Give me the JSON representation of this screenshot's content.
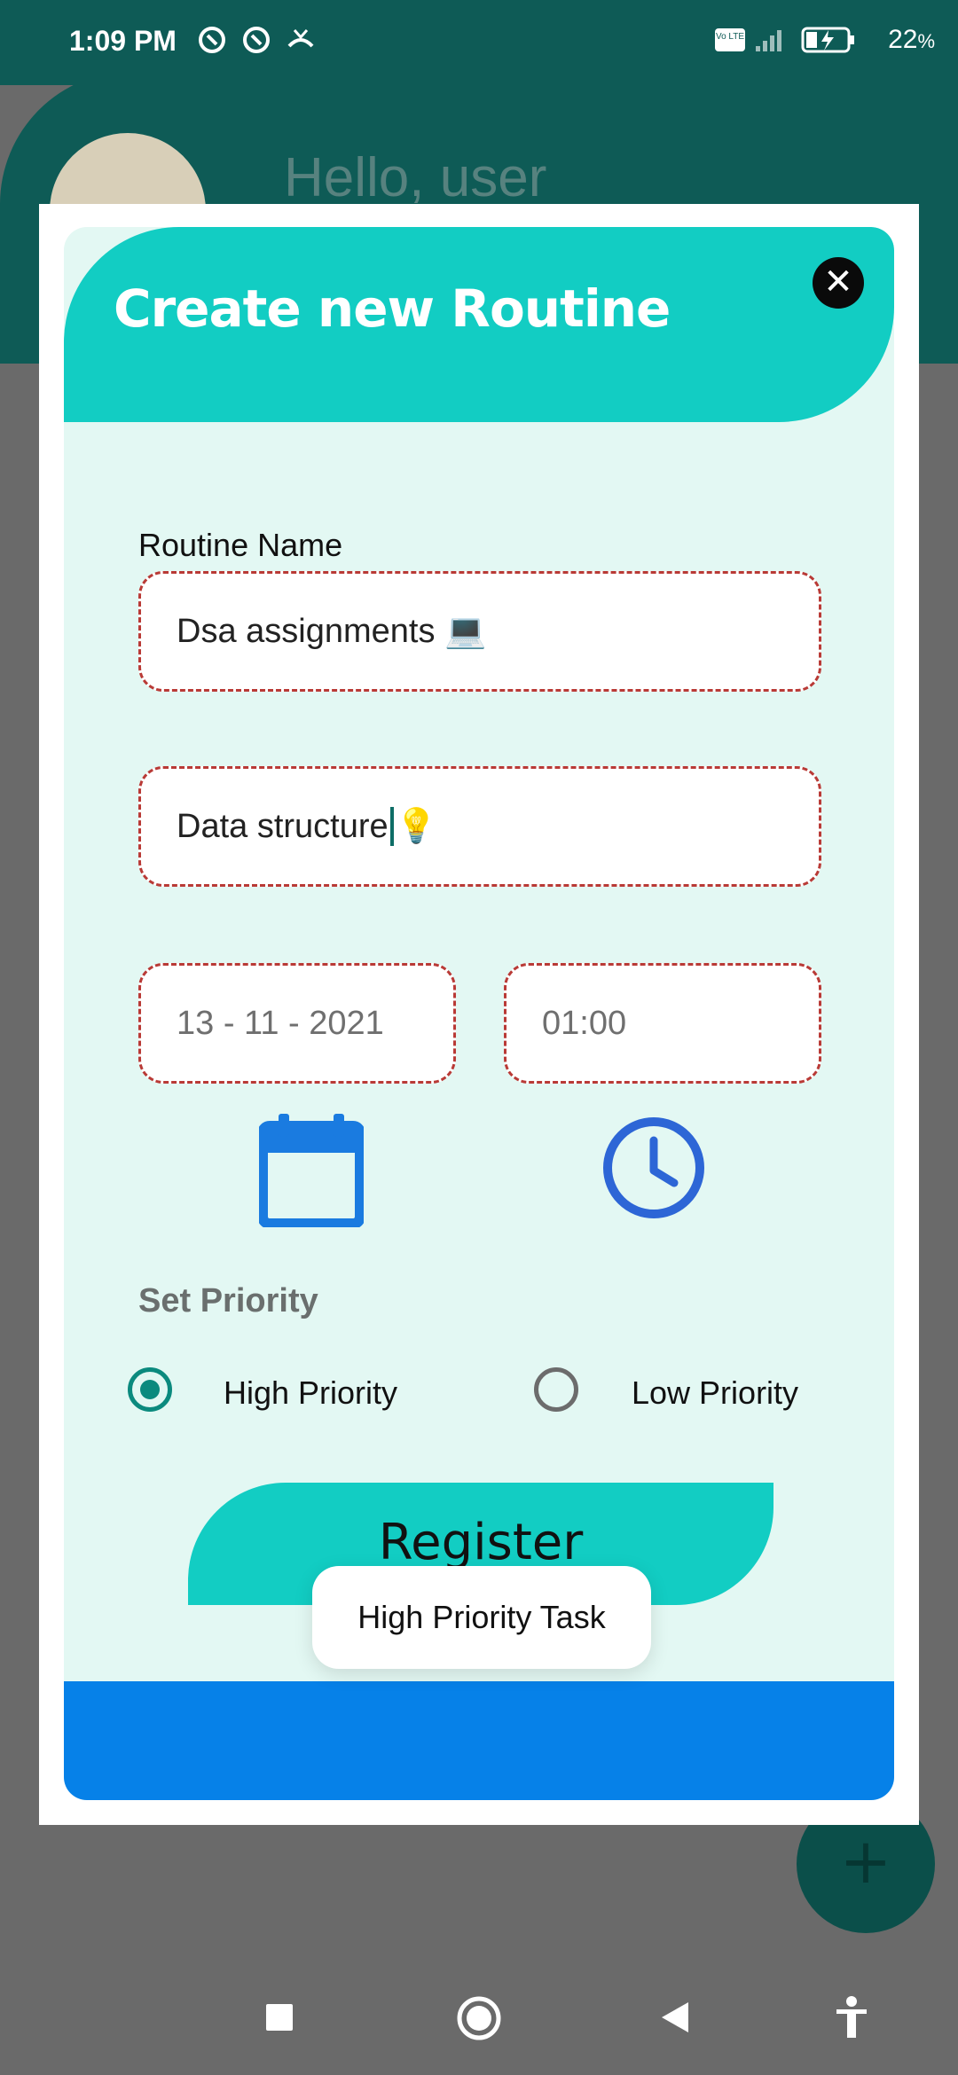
{
  "status_bar": {
    "time": "1:09 PM",
    "battery_percent": "22",
    "battery_unit": "%",
    "network_badge": "Vo LTE"
  },
  "background_app": {
    "greeting": "Hello, user",
    "fab_symbol": "+"
  },
  "dialog": {
    "title": "Create new Routine",
    "close_symbol": "✕",
    "routine_name_label": "Routine Name",
    "routine_name_value": "Dsa assignments 💻",
    "description_value": "Data structure",
    "description_emoji": "💡",
    "date_value": "13 - 11 - 2021",
    "time_value": "01:00",
    "priority_heading": "Set Priority",
    "priority_options": [
      {
        "label": "High Priority",
        "selected": true
      },
      {
        "label": "Low Priority",
        "selected": false
      }
    ],
    "register_label": "Register",
    "toast_text": "High Priority Task"
  },
  "colors": {
    "accent": "#12cdc3",
    "dark_teal": "#0e5b56",
    "dashed_border": "#b93a36",
    "bottom_bar": "#0681e8",
    "icon_blue": "#1a7be0"
  }
}
